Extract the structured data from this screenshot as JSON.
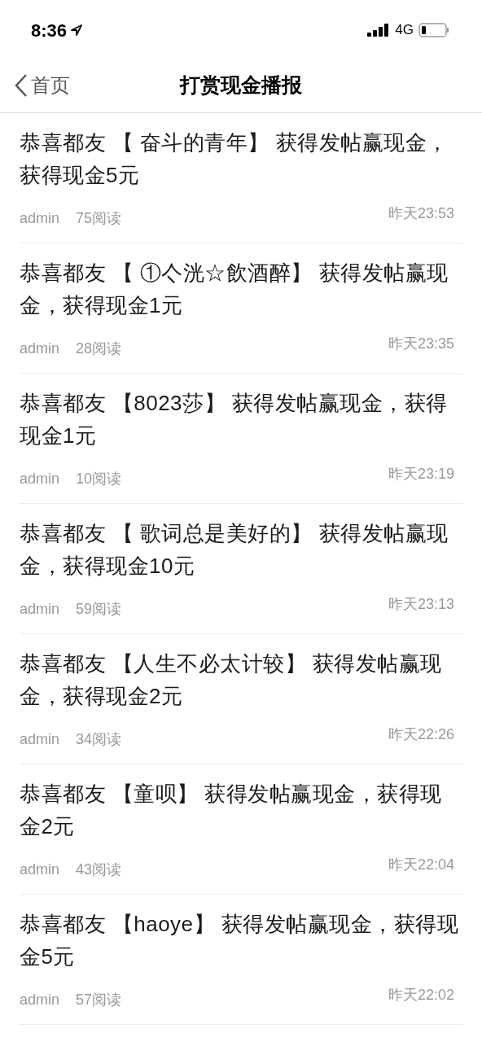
{
  "status_bar": {
    "time": "8:36",
    "network": "4G"
  },
  "nav": {
    "back": "首页",
    "title": "打赏现金播报"
  },
  "posts": [
    {
      "title": "恭喜都友 【 奋斗的青年】 获得发帖赢现金，获得现金5元",
      "author": "admin",
      "reads": "75阅读",
      "time": "昨天23:53"
    },
    {
      "title": "恭喜都友 【 ①亽洸☆飲酒醉】 获得发帖赢现金，获得现金1元",
      "author": "admin",
      "reads": "28阅读",
      "time": "昨天23:35"
    },
    {
      "title": "恭喜都友 【8023莎】 获得发帖赢现金，获得现金1元",
      "author": "admin",
      "reads": "10阅读",
      "time": "昨天23:19"
    },
    {
      "title": "恭喜都友 【 歌词总是美好的】 获得发帖赢现金，获得现金10元",
      "author": "admin",
      "reads": "59阅读",
      "time": "昨天23:13"
    },
    {
      "title": "恭喜都友 【人生不必太计较】 获得发帖赢现金，获得现金2元",
      "author": "admin",
      "reads": "34阅读",
      "time": "昨天22:26"
    },
    {
      "title": "恭喜都友 【童呗】 获得发帖赢现金，获得现金2元",
      "author": "admin",
      "reads": "43阅读",
      "time": "昨天22:04"
    },
    {
      "title": "恭喜都友 【haoye】 获得发帖赢现金，获得现金5元",
      "author": "admin",
      "reads": "57阅读",
      "time": "昨天22:02"
    }
  ]
}
